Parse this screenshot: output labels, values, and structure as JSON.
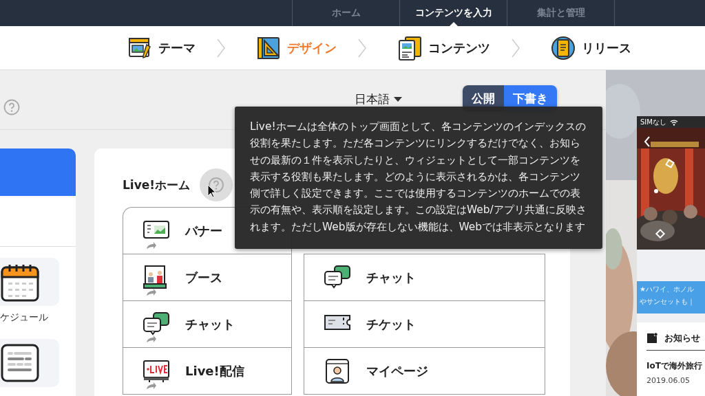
{
  "top_nav": {
    "tabs": [
      {
        "label": "ホーム",
        "selected": false
      },
      {
        "label": "コンテンツを入力",
        "selected": true
      },
      {
        "label": "集計と管理",
        "selected": false
      }
    ]
  },
  "steps": [
    {
      "kind": "theme",
      "label": "テーマ",
      "selected": false
    },
    {
      "kind": "design",
      "label": "デザイン",
      "selected": true
    },
    {
      "kind": "contents",
      "label": "コンテンツ",
      "selected": false
    },
    {
      "kind": "release",
      "label": "リリース",
      "selected": false
    }
  ],
  "toolbar": {
    "language": "日本語",
    "publish_toggle": [
      {
        "label": "公開",
        "selected": false
      },
      {
        "label": "下書き",
        "selected": true
      }
    ]
  },
  "side_card": {
    "tiles": [
      {
        "kind": "calendar",
        "label": "ケジュール"
      },
      {
        "kind": "list"
      }
    ]
  },
  "home_card": {
    "title": "Live!ホーム",
    "columns": [
      [
        {
          "kind": "banner",
          "label": "バナー",
          "shared": true
        },
        {
          "kind": "booth",
          "label": "ブース",
          "shared": true
        },
        {
          "kind": "chat",
          "label": "チャット",
          "shared": true
        },
        {
          "kind": "live",
          "label": "Live!配信",
          "shared": true
        }
      ],
      [
        {
          "kind": "chat",
          "label": "チャット",
          "shared": false
        },
        {
          "kind": "ticket",
          "label": "チケット",
          "shared": false
        },
        {
          "kind": "mypage",
          "label": "マイページ",
          "shared": false
        }
      ]
    ]
  },
  "tooltip": {
    "text": "Live!ホームは全体のトップ画面として、各コンテンツのインデックスの役割を果たします。ただ各コンテンツにリンクするだけでなく、お知らせの最新の１件を表示したりと、ウィジェットとして一部コンテンツを表示する役割も果たします。どのように表示されるかは、各コンテンツ側で詳しく設定できます。ここでは使用するコンテンツのホームでの表示の有無や、表示順を設定します。この設定はWeb/アプリ共通に反映されます。ただしWeb版が存在しない機能は、Webでは非表示となります"
  },
  "preview": {
    "carrier": "SIMなし",
    "banner_lines": [
      "★ハワイ、ホノル",
      "やサンセットも｜"
    ],
    "news": {
      "heading": "お知らせ",
      "items": [
        {
          "title": "IoTで海外旅行",
          "date": "2019.06.05"
        }
      ]
    }
  }
}
